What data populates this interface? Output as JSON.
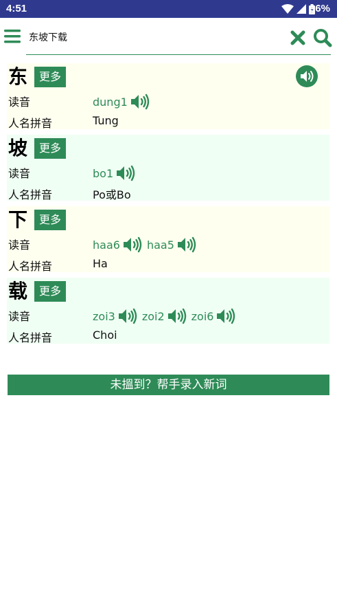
{
  "status_bar": {
    "time": "4:51",
    "battery": "96%"
  },
  "search": {
    "query": "东坡下载"
  },
  "entries": [
    {
      "char": "东",
      "more_label": "更多",
      "reading_label": "读音",
      "readings": [
        "dung1"
      ],
      "name_label": "人名拼音",
      "name_pinyin": "Tung"
    },
    {
      "char": "坡",
      "more_label": "更多",
      "reading_label": "读音",
      "readings": [
        "bo1"
      ],
      "name_label": "人名拼音",
      "name_pinyin": "Po或Bo"
    },
    {
      "char": "下",
      "more_label": "更多",
      "reading_label": "读音",
      "readings": [
        "haa6",
        "haa5"
      ],
      "name_label": "人名拼音",
      "name_pinyin": "Ha"
    },
    {
      "char": "载",
      "more_label": "更多",
      "reading_label": "读音",
      "readings": [
        "zoi3",
        "zoi2",
        "zoi6"
      ],
      "name_label": "人名拼音",
      "name_pinyin": "Choi"
    }
  ],
  "contribute_button": "未搵到？帮手录入新词",
  "colors": {
    "status_bar": "#2f3a8f",
    "accent": "#2e8b57",
    "entry_yellow": "#fffff0",
    "entry_green": "#f0fff4"
  },
  "icons": [
    "wifi-icon",
    "signal-icon",
    "battery-icon",
    "menu-icon",
    "clear-icon",
    "search-icon",
    "speaker-icon"
  ]
}
